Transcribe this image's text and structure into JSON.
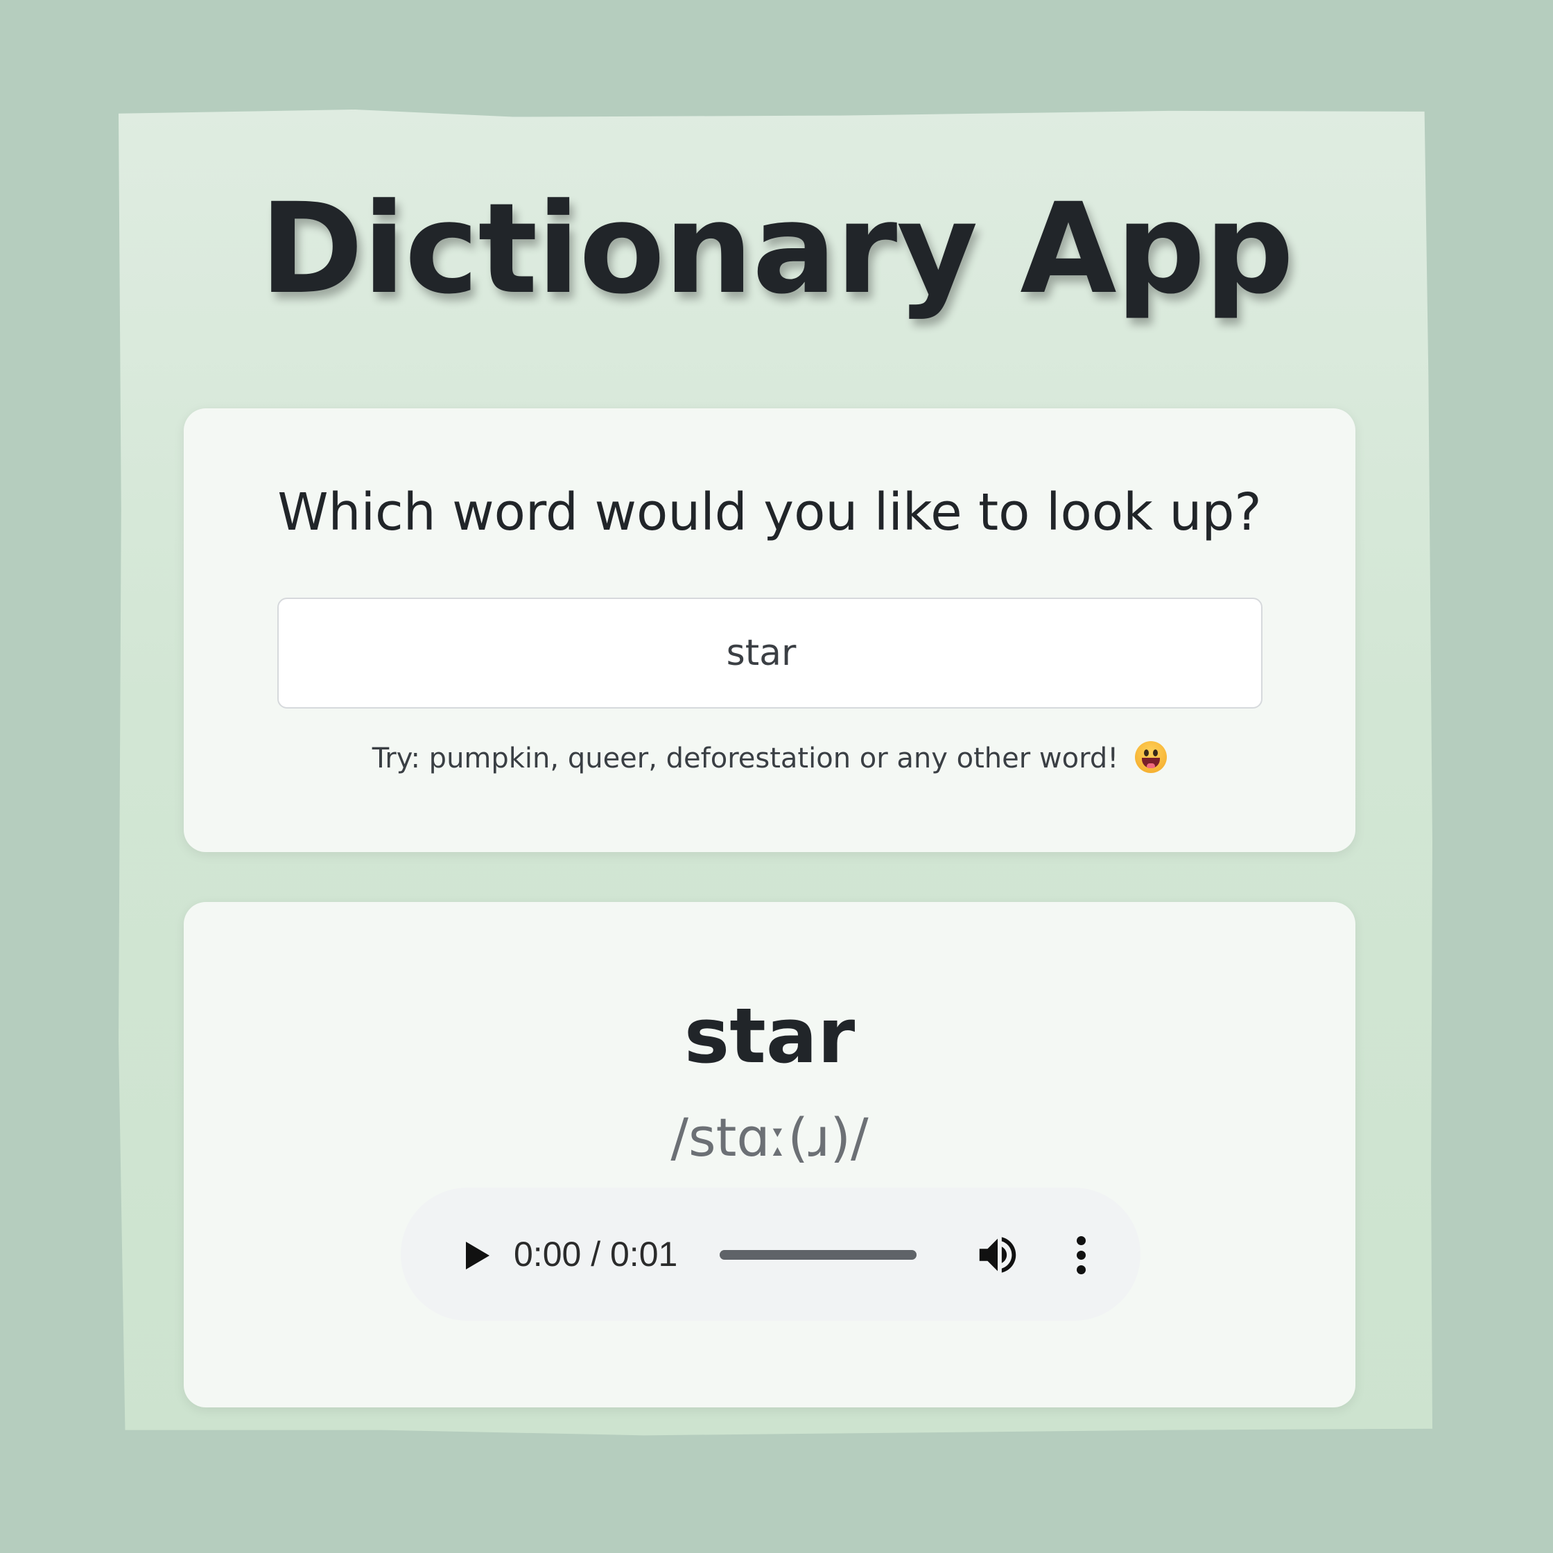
{
  "app": {
    "title": "Dictionary App"
  },
  "search": {
    "question": "Which word would you like to look up?",
    "value": "star",
    "hint": "Try: pumpkin, queer, deforestation or any other word!",
    "hint_emoji": "grinning-face-with-tongue-icon"
  },
  "result": {
    "word": "star",
    "phonetic": "/stɑː(ɹ)/",
    "audio": {
      "time_display": "0:00 / 0:01",
      "progress": 1.0,
      "play_icon": "play-icon",
      "volume_icon": "volume-icon",
      "menu_icon": "more-vert-icon"
    }
  },
  "colors": {
    "background": "#b5cdbe",
    "panel": "#d6e8d8",
    "card": "#f4f8f4",
    "text": "#212529",
    "phonetic": "#6c7075"
  }
}
